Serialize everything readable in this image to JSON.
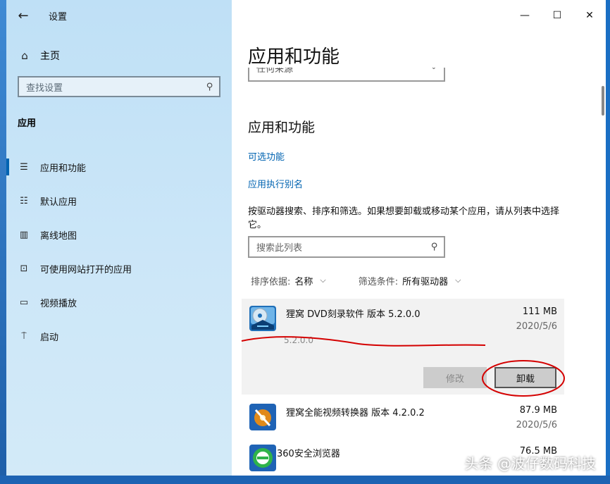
{
  "sidebar": {
    "back_icon": "back-arrow-icon",
    "title": "设置",
    "home_label": "主页",
    "search_placeholder": "查找设置",
    "section_title": "应用",
    "items": [
      {
        "label": "应用和功能",
        "icon": "apps-list-icon",
        "active": true
      },
      {
        "label": "默认应用",
        "icon": "default-apps-icon",
        "active": false
      },
      {
        "label": "离线地图",
        "icon": "offline-map-icon",
        "active": false
      },
      {
        "label": "可使用网站打开的应用",
        "icon": "web-apps-icon",
        "active": false
      },
      {
        "label": "视频播放",
        "icon": "video-icon",
        "active": false
      },
      {
        "label": "启动",
        "icon": "startup-icon",
        "active": false
      }
    ]
  },
  "titlebar": {
    "minimize": "—",
    "maximize": "☐",
    "close": "✕"
  },
  "main": {
    "page_title": "应用和功能",
    "filter_remnant_text": "任何来源",
    "sub_title": "应用和功能",
    "link_optional": "可选功能",
    "link_alias": "应用执行别名",
    "description": "按驱动器搜索、排序和筛选。如果想要卸载或移动某个应用，请从列表中选择它。",
    "list_search_placeholder": "搜索此列表",
    "sort_key": "排序依据:",
    "sort_value": "名称",
    "filter_key": "筛选条件:",
    "filter_value": "所有驱动器"
  },
  "apps": [
    {
      "name": "狸窝 DVD刻录软件 版本 5.2.0.0",
      "size": "111 MB",
      "date": "2020/5/6",
      "version": "5.2.0.0",
      "selected": true
    },
    {
      "name": "狸窝全能视频转换器 版本 4.2.0.2",
      "size": "87.9 MB",
      "date": "2020/5/6"
    },
    {
      "name": "360安全浏览器",
      "size": "76.5 MB",
      "date": ""
    }
  ],
  "buttons": {
    "modify": "修改",
    "uninstall": "卸载"
  },
  "watermark": "头条 @波仔数码科技",
  "colors": {
    "accent": "#0063b1",
    "sidebar_bg": "#c6e4f7",
    "annotation_red": "#d40000"
  }
}
